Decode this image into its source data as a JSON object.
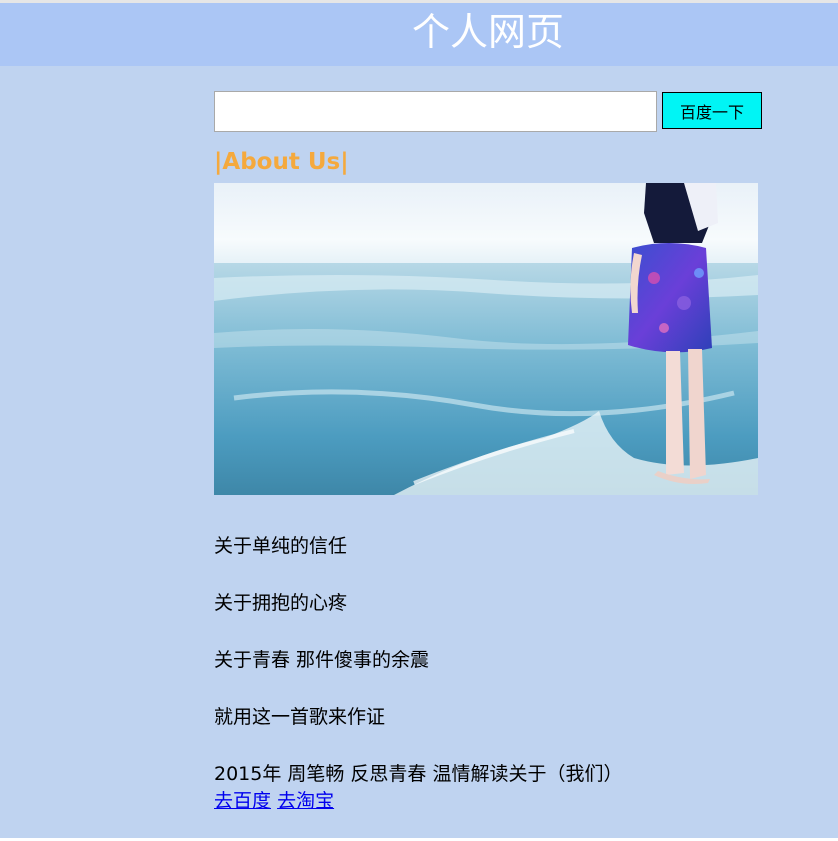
{
  "header": {
    "title": "个人网页"
  },
  "search": {
    "placeholder": "",
    "value": "",
    "button_label": "百度一下"
  },
  "about": {
    "heading": "|About Us|"
  },
  "hero_image": {
    "description_icon": "photo-girl-at-beach"
  },
  "lyrics": [
    "关于单纯的信任",
    "关于拥抱的心疼",
    "关于青春 那件傻事的余震",
    "就用这一首歌来作证",
    "2015年 周笔畅 反思青春 温情解读关于（我们）"
  ],
  "links": [
    {
      "label": "去百度"
    },
    {
      "label": "去淘宝"
    }
  ],
  "colors": {
    "page_bg": "#bfd3f0",
    "header_bg": "#abc6f5",
    "heading": "#f5a93d",
    "button_bg": "#00f5f5",
    "link": "#0000ee"
  }
}
